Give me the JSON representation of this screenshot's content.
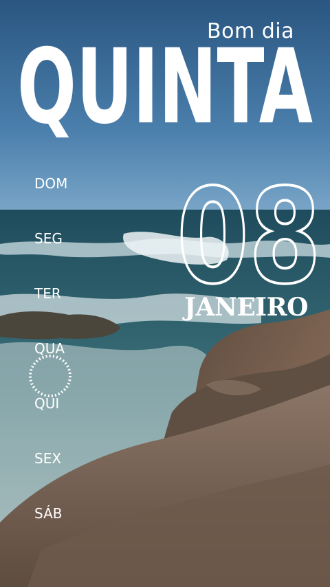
{
  "greeting": "Bom dia",
  "weekday": "QUINTA",
  "date": {
    "day": "08",
    "month": "JANEIRO"
  },
  "week": {
    "days": [
      "DOM",
      "SEG",
      "TER",
      "QUA",
      "QUI",
      "SEX",
      "SÁB"
    ],
    "highlighted": "QUI"
  },
  "colors": {
    "sky_top": "#2f5c86",
    "sky_bottom": "#5a8db8",
    "sea": "#2c6069",
    "foam": "#d9e6ea",
    "rock": "#6a5546",
    "text": "#ffffff"
  }
}
